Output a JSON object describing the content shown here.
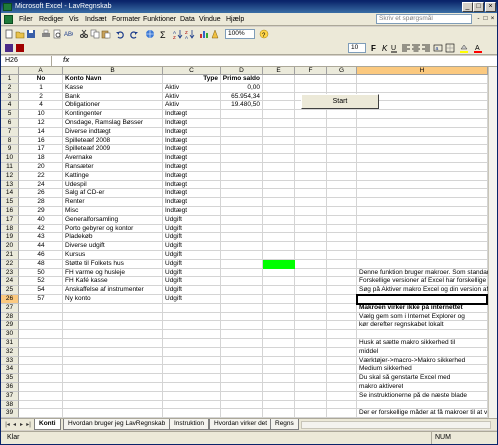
{
  "window": {
    "title": "Microsoft Excel - LavRegnskab",
    "buttons": [
      "_",
      "□",
      "×"
    ]
  },
  "menubar": {
    "items": [
      "Filer",
      "Rediger",
      "Vis",
      "Indsæt",
      "Formater",
      "Funktioner",
      "Data",
      "Vindue",
      "Hjælp"
    ],
    "ask_placeholder": "Skriv et spørgsmål",
    "doc_buttons": [
      "-",
      "□",
      "×"
    ]
  },
  "toolbar": {
    "zoom": "100%",
    "font_size": "10"
  },
  "formula_bar": {
    "name_box": "H26",
    "fx": "fx",
    "content": ""
  },
  "columns": [
    "A",
    "B",
    "C",
    "D",
    "E",
    "F",
    "G",
    "H"
  ],
  "header_row": {
    "no": "No",
    "konto_navn": "Konto Navn",
    "type": "Type",
    "primo": "Primo saldo"
  },
  "accounts": [
    {
      "no": "1",
      "name": "Kasse",
      "type": "Aktiv",
      "saldo": "0,00"
    },
    {
      "no": "2",
      "name": "Bank",
      "type": "Aktiv",
      "saldo": "65.954,34"
    },
    {
      "no": "4",
      "name": "Obligationer",
      "type": "Aktiv",
      "saldo": "19.480,50"
    },
    {
      "no": "10",
      "name": "Kontingenter",
      "type": "Indtægt",
      "saldo": ""
    },
    {
      "no": "12",
      "name": "Onsdage, Ramslag Bøsser",
      "type": "Indtægt",
      "saldo": ""
    },
    {
      "no": "14",
      "name": "Diverse indtægt",
      "type": "Indtægt",
      "saldo": ""
    },
    {
      "no": "16",
      "name": "Spilleteæf 2008",
      "type": "Indtægt",
      "saldo": ""
    },
    {
      "no": "17",
      "name": "Spilleteæf 2009",
      "type": "Indtægt",
      "saldo": ""
    },
    {
      "no": "18",
      "name": "Avernake",
      "type": "Indtægt",
      "saldo": ""
    },
    {
      "no": "20",
      "name": "Ransæter",
      "type": "Indtægt",
      "saldo": ""
    },
    {
      "no": "22",
      "name": "Kattinge",
      "type": "Indtægt",
      "saldo": ""
    },
    {
      "no": "24",
      "name": "Udespil",
      "type": "Indtægt",
      "saldo": ""
    },
    {
      "no": "26",
      "name": "Salg af CD-er",
      "type": "Indtægt",
      "saldo": ""
    },
    {
      "no": "28",
      "name": "Renter",
      "type": "Indtægt",
      "saldo": ""
    },
    {
      "no": "29",
      "name": "Misc",
      "type": "Indtægt",
      "saldo": ""
    },
    {
      "no": "40",
      "name": "Generalforsamling",
      "type": "Udgift",
      "saldo": ""
    },
    {
      "no": "42",
      "name": "Porto gebyrer og kontor",
      "type": "Udgift",
      "saldo": ""
    },
    {
      "no": "43",
      "name": "Pladekøb",
      "type": "Udgift",
      "saldo": ""
    },
    {
      "no": "44",
      "name": "Diverse udgift",
      "type": "Udgift",
      "saldo": ""
    },
    {
      "no": "46",
      "name": "Kursus",
      "type": "Udgift",
      "saldo": ""
    },
    {
      "no": "48",
      "name": "Støtte til Folkets hus",
      "type": "Udgift",
      "saldo": ""
    },
    {
      "no": "50",
      "name": "FH varme  og husleje",
      "type": "Udgift",
      "saldo": ""
    },
    {
      "no": "52",
      "name": "FH Kafé kasse",
      "type": "Udgift",
      "saldo": ""
    },
    {
      "no": "54",
      "name": "Anskaffelse af instrumenter",
      "type": "Udgift",
      "saldo": ""
    },
    {
      "no": "57",
      "name": "Ny konto",
      "type": "Udgift",
      "saldo": ""
    }
  ],
  "row_numbers": [
    "1",
    "2",
    "3",
    "4",
    "5",
    "6",
    "7",
    "8",
    "9",
    "10",
    "11",
    "12",
    "13",
    "14",
    "15",
    "16",
    "17",
    "18",
    "19",
    "20",
    "21",
    "22",
    "23",
    "24",
    "25",
    "26",
    "27",
    "28",
    "29",
    "30",
    "31",
    "32",
    "33",
    "34",
    "35",
    "36",
    "37",
    "38",
    "39"
  ],
  "start_button": "Start",
  "notes": {
    "r23": "Denne funktion bruger makroer. Som standard",
    "r24": "Forskellige versioner af Excel har forskellige",
    "r25": "Søg på Aktiver makro Excel og din version af",
    "r27": "Makroen virker ikke på internettet",
    "r28": "Vælg gem som i Internet Explorer og",
    "r29": "kør derefter regnskabet lokalt",
    "r31": "Husk at sætte makro sikkerhed til",
    "r32": "middel",
    "r33": "Værktøjer->macro->Makro sikkerhed",
    "r34": "Medium sikkerhed",
    "r35": "Du skal så genstarte Excel med",
    "r36": "makro aktiveret",
    "r37": "Se instruktionerne på de næste blade",
    "r39": "Der er forskellige måder at få makroer til at v"
  },
  "sheet_tabs": [
    "Konti",
    "Hvordan bruger jeg LavRegnskab",
    "Instruktion",
    "Hvordan virker det",
    "Regns"
  ],
  "status": {
    "mode": "Klar",
    "num": "NUM"
  },
  "colors": {
    "green_cell": "#00ff00",
    "selection_row": "#fbc97f"
  }
}
